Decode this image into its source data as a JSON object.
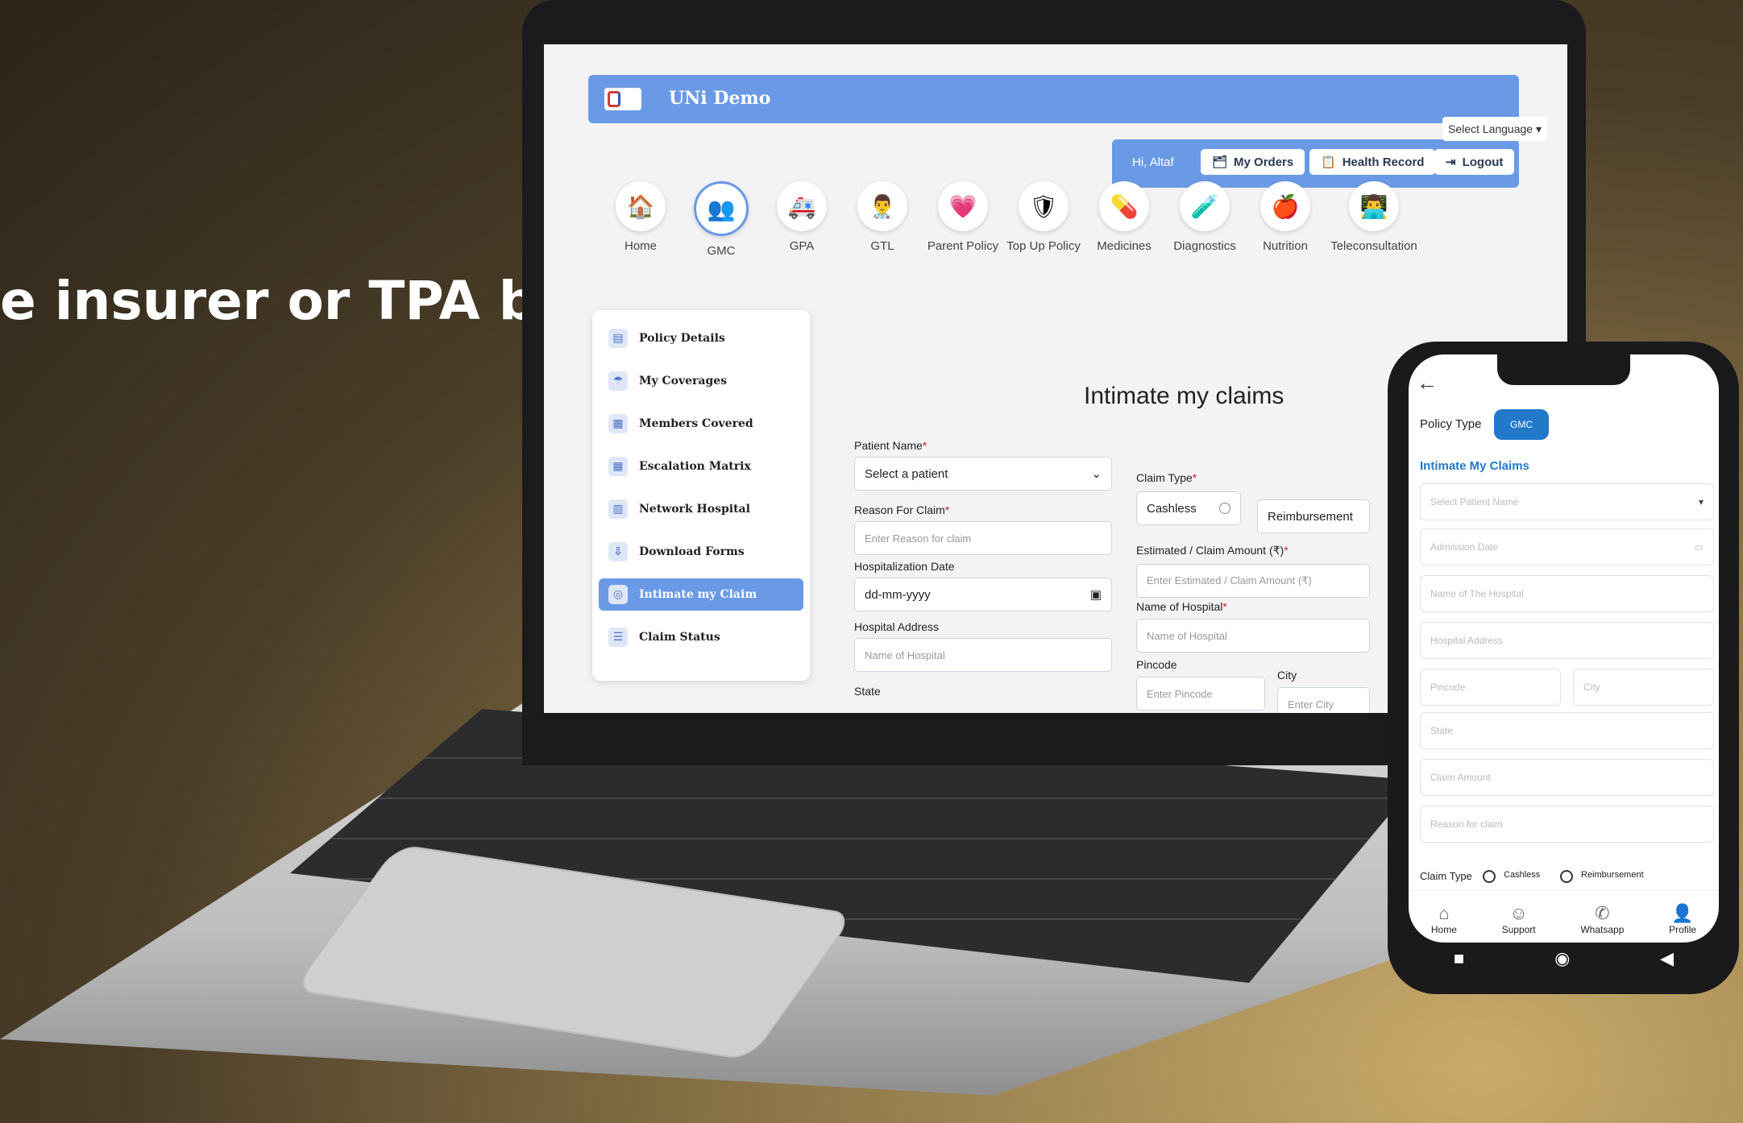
{
  "headline": "e insurer or TPA by",
  "app": {
    "brand_name": "UNi Demo",
    "greeting": "Hi, Altaf",
    "select_language": "Select Language ▾",
    "buttons": {
      "my_orders": "My Orders",
      "health_record": "Health Record",
      "logout": "Logout"
    },
    "nav": [
      {
        "label": "Home",
        "icon": "home-icon",
        "glyph": "🏠"
      },
      {
        "label": "GMC",
        "icon": "gmc-icon",
        "glyph": "👥"
      },
      {
        "label": "GPA",
        "icon": "gpa-icon",
        "glyph": "🚑"
      },
      {
        "label": "GTL",
        "icon": "gtl-icon",
        "glyph": "👨‍⚕️"
      },
      {
        "label": "Parent Policy",
        "icon": "parent-policy-icon",
        "glyph": "💗"
      },
      {
        "label": "Top Up Policy",
        "icon": "top-up-policy-icon",
        "glyph": "🛡"
      },
      {
        "label": "Medicines",
        "icon": "medicines-icon",
        "glyph": "💊"
      },
      {
        "label": "Diagnostics",
        "icon": "diagnostics-icon",
        "glyph": "🧪"
      },
      {
        "label": "Nutrition",
        "icon": "nutrition-icon",
        "glyph": "🍎"
      },
      {
        "label": "Teleconsultation",
        "icon": "teleconsultation-icon",
        "glyph": "👨‍💻"
      }
    ],
    "sidebar": [
      {
        "label": "Policy Details",
        "icon": "policy-details-icon"
      },
      {
        "label": "My Coverages",
        "icon": "my-coverages-icon"
      },
      {
        "label": "Members Covered",
        "icon": "members-covered-icon"
      },
      {
        "label": "Escalation Matrix",
        "icon": "escalation-matrix-icon"
      },
      {
        "label": "Network Hospital",
        "icon": "network-hospital-icon"
      },
      {
        "label": "Download Forms",
        "icon": "download-forms-icon"
      },
      {
        "label": "Intimate my Claim",
        "icon": "intimate-claim-icon"
      },
      {
        "label": "Claim Status",
        "icon": "claim-status-icon"
      }
    ],
    "form": {
      "title": "Intimate my claims",
      "patient_name_label": "Patient Name",
      "patient_name_value": "Select a patient",
      "claim_type_label": "Claim Type",
      "cashless": "Cashless",
      "reimbursement": "Reimbursement",
      "reason_label": "Reason For Claim",
      "reason_placeholder": "Enter Reason for claim",
      "estimated_label": "Estimated / Claim Amount (₹)",
      "estimated_placeholder": "Enter Estimated / Claim Amount (₹)",
      "hosp_date_label": "Hospitalization Date",
      "hosp_date_value": "dd-mm-yyyy",
      "hosp_name_label": "Name of Hospital",
      "hosp_name_placeholder": "Name of Hospital",
      "hosp_address_label": "Hospital Address",
      "hosp_address_placeholder": "Name of Hospital",
      "pincode_label": "Pincode",
      "pincode_placeholder": "Enter Pincode",
      "city_label": "City",
      "city_placeholder": "Enter City",
      "state_label": "State"
    },
    "colors": {
      "header": "#6a9ae6",
      "accent": "#2279c9"
    }
  },
  "phone": {
    "policy_type_label": "Policy Type",
    "policy_type_value": "GMC",
    "title": "Intimate My Claims",
    "fields": {
      "patient": "Select Patient Name",
      "admission_date": "Admission Date",
      "hospital_name": "Name of The Hospital",
      "hospital_address": "Hospital Address",
      "pincode": "Pincode",
      "city": "City",
      "state": "State",
      "claim_amount": "Claim Amount",
      "reason": "Reason for claim"
    },
    "claim_type_label": "Claim Type",
    "cashless": "Cashless",
    "reimbursement": "Reimbursement",
    "bottom_nav": [
      {
        "label": "Home",
        "icon": "home-icon",
        "glyph": "⌂"
      },
      {
        "label": "Support",
        "icon": "support-icon",
        "glyph": "☺"
      },
      {
        "label": "Whatsapp",
        "icon": "whatsapp-icon",
        "glyph": "✆"
      },
      {
        "label": "Profile",
        "icon": "profile-icon",
        "glyph": "👤"
      }
    ]
  }
}
